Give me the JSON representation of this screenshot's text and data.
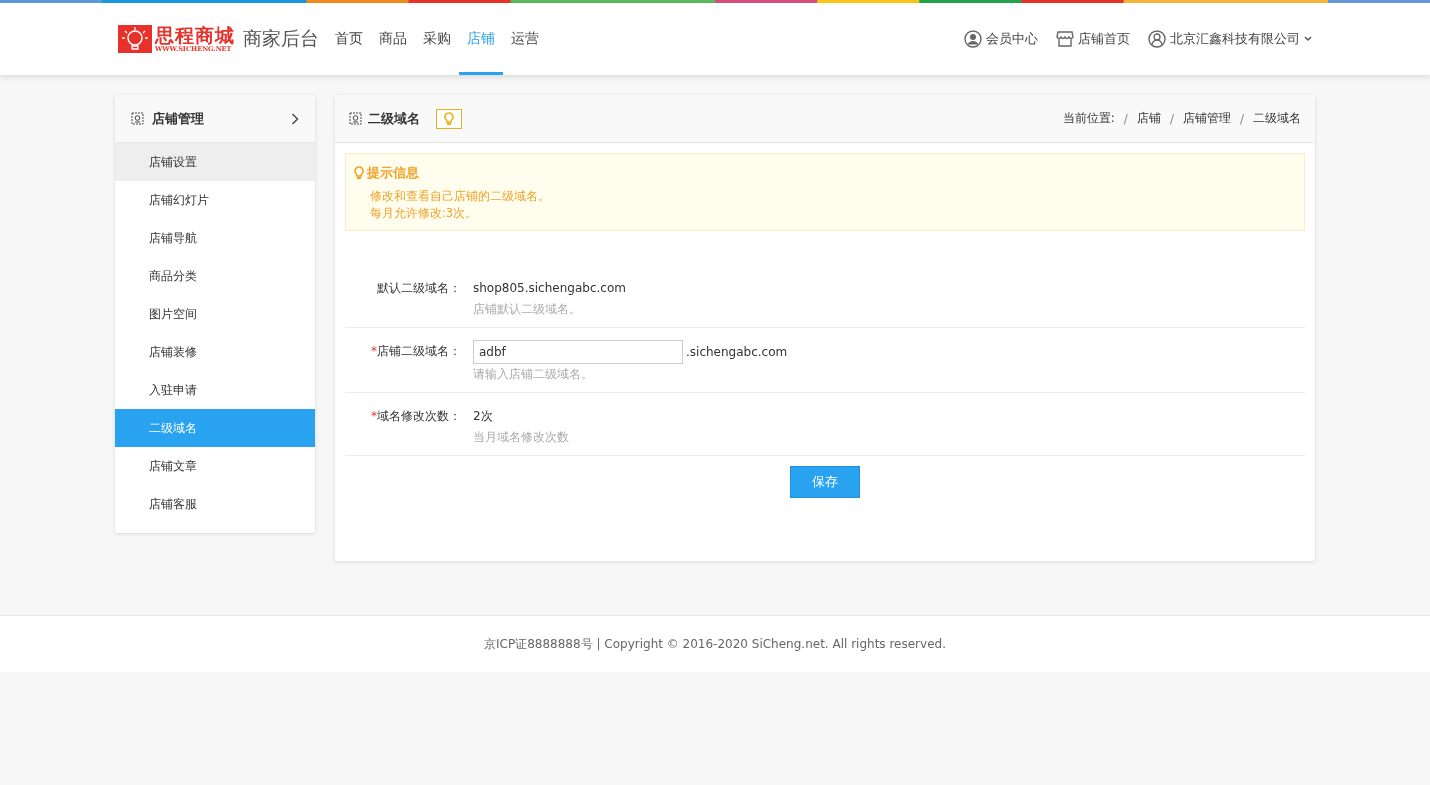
{
  "header": {
    "logo_title": "思程商城",
    "logo_url": "WWW.SICHENG.NET",
    "app_title": "商家后台",
    "nav": [
      {
        "label": "首页",
        "selected": false
      },
      {
        "label": "商品",
        "selected": false
      },
      {
        "label": "采购",
        "selected": false
      },
      {
        "label": "店铺",
        "selected": true
      },
      {
        "label": "运营",
        "selected": false
      }
    ],
    "links": [
      {
        "kind": "member",
        "label": "会员中心"
      },
      {
        "kind": "store",
        "label": "店铺首页"
      },
      {
        "kind": "account",
        "label": "北京汇鑫科技有限公司"
      }
    ]
  },
  "sidebar": {
    "title": "店铺管理",
    "items": [
      {
        "label": "店铺设置",
        "selected": false,
        "hovered": true
      },
      {
        "label": "店铺幻灯片",
        "selected": false,
        "hovered": false
      },
      {
        "label": "店铺导航",
        "selected": false,
        "hovered": false
      },
      {
        "label": "商品分类",
        "selected": false,
        "hovered": false
      },
      {
        "label": "图片空间",
        "selected": false,
        "hovered": false
      },
      {
        "label": "店铺装修",
        "selected": false,
        "hovered": false
      },
      {
        "label": "入驻申请",
        "selected": false,
        "hovered": false
      },
      {
        "label": "二级域名",
        "selected": true,
        "hovered": false
      },
      {
        "label": "店铺文章",
        "selected": false,
        "hovered": false
      },
      {
        "label": "店铺客服",
        "selected": false,
        "hovered": false
      }
    ]
  },
  "panel": {
    "title": "二级域名",
    "breadcrumb": [
      {
        "kind": "label",
        "text": "当前位置:"
      },
      {
        "kind": "separator",
        "text": "/"
      },
      {
        "kind": "link",
        "text": "店铺"
      },
      {
        "kind": "separator",
        "text": "/"
      },
      {
        "kind": "link",
        "text": "店铺管理"
      },
      {
        "kind": "separator",
        "text": "/"
      },
      {
        "kind": "link",
        "text": "二级域名"
      }
    ],
    "tip": {
      "title": "提示信息",
      "lines": [
        "修改和查看自己店铺的二级域名。",
        "每月允许修改:3次。"
      ]
    },
    "rows": [
      {
        "kind": "text",
        "label": "默认二级域名：",
        "value": "shop805.sichengabc.com",
        "hint": "店铺默认二级域名。"
      },
      {
        "kind": "input",
        "required_mark": "*",
        "label": "店铺二级域名：",
        "value": "adbf",
        "suffix": ".sichengabc.com",
        "hint": "请输入店铺二级域名。"
      },
      {
        "kind": "text",
        "required_mark": "*",
        "label": "域名修改次数：",
        "value": "2次",
        "hint": "当月域名修改次数"
      }
    ],
    "save_button": "保存"
  },
  "footer": "京ICP证8888888号 | Copyright © 2016-2020 SiCheng.net. All rights reserved."
}
